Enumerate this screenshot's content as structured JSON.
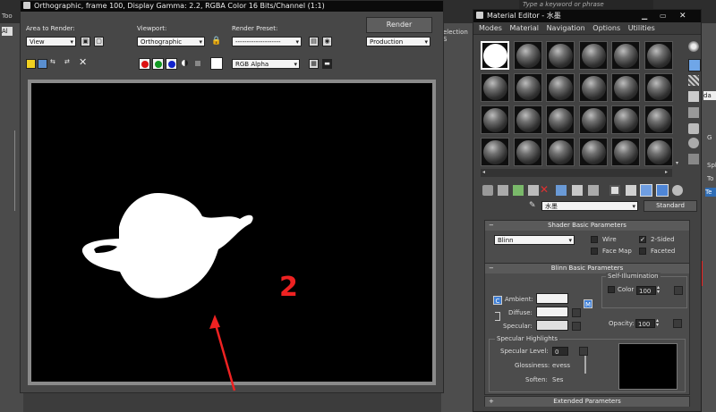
{
  "background_app": {
    "top_left_text": "Too",
    "left_box_text": "Al",
    "selection_text": "election S",
    "search_placeholder": "Type a keyword or phrase",
    "right_field_text": "da",
    "right_labels": [
      "G",
      "Spl",
      "To",
      "Te"
    ]
  },
  "render_window": {
    "title": "Orthographic, frame 100, Display Gamma: 2.2, RGBA Color 16 Bits/Channel (1:1)",
    "area_label": "Area to Render:",
    "area_value": "View",
    "viewport_label": "Viewport:",
    "viewport_value": "Orthographic",
    "preset_label": "Render Preset:",
    "preset_value": "--------------------",
    "render_button": "Render",
    "production_value": "Production",
    "channel_value": "RGB Alpha"
  },
  "annotations": {
    "number_label": "2"
  },
  "material_editor": {
    "title": "Material Editor - 水墨",
    "menu": [
      "Modes",
      "Material",
      "Navigation",
      "Options",
      "Utilities"
    ],
    "material_name": "水墨",
    "material_type_button": "Standard",
    "shader_rollout": {
      "title": "Shader Basic Parameters",
      "shader_value": "Blinn",
      "wire_label": "Wire",
      "two_sided_label": "2-Sided",
      "face_map_label": "Face Map",
      "faceted_label": "Faceted"
    },
    "blinn_rollout": {
      "title": "Blinn Basic Parameters",
      "self_illum_title": "Self-Illumination",
      "color_label": "Color",
      "color_value": "100",
      "ambient_label": "Ambient:",
      "diffuse_label": "Diffuse:",
      "specular_label": "Specular:",
      "opacity_label": "Opacity:",
      "opacity_value": "100",
      "lock_label": "C"
    },
    "specular_section": {
      "title": "Specular Highlights",
      "level_label": "Specular Level:",
      "level_value": "0",
      "glossiness_label": "Glossiness:",
      "glossiness_value": "evess",
      "soften_label": "Soften:",
      "soften_value": "Ses"
    },
    "extended_rollout": {
      "title": "Extended Parameters"
    }
  },
  "colors": {
    "annotation_red": "#ee2222",
    "sample_slot_selected": "#ffffff",
    "render_background": "#000000"
  }
}
